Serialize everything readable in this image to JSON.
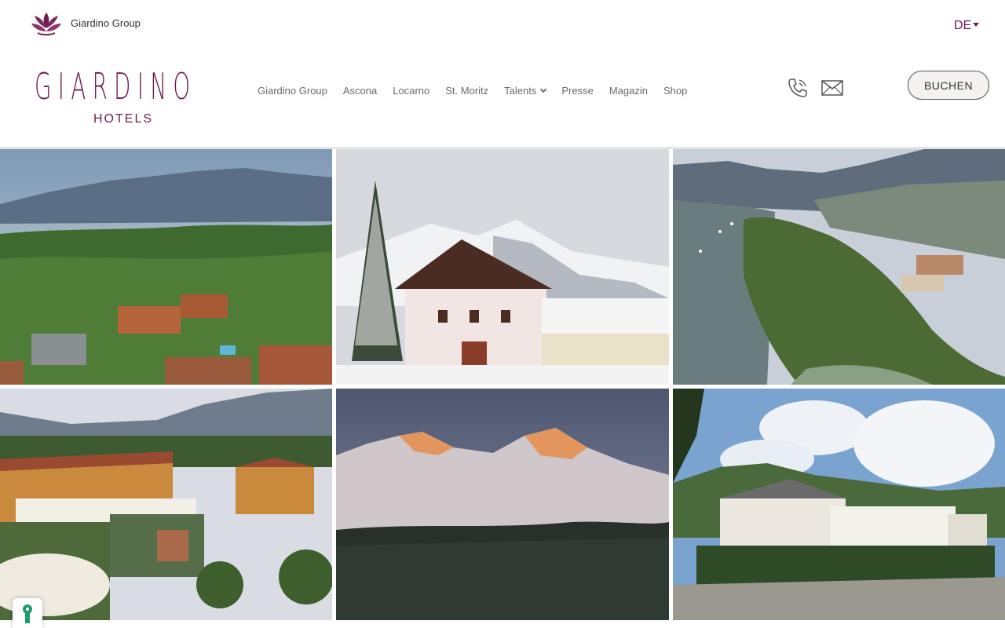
{
  "header": {
    "group_label": "Giardino Group",
    "language": "DE",
    "brand_word": "GIARDINO",
    "brand_sub": "HOTELS",
    "book_label": "BUCHEN",
    "icons": {
      "group_logo": "lotus-icon",
      "phone": "phone-icon",
      "mail": "mail-icon",
      "cookie": "key-icon"
    }
  },
  "nav": {
    "items": [
      "Giardino Group",
      "Ascona",
      "Locarno",
      "St. Moritz",
      "Talents",
      "Presse",
      "Magazin",
      "Shop"
    ]
  },
  "gallery": {
    "tiles": [
      "aerial-ascona-resort",
      "snowy-st-moritz-chalet",
      "lake-maggiore-shore",
      "courtyard-garden-hotel",
      "alpenglow-peaks",
      "villa-locarno"
    ]
  },
  "colors": {
    "brand": "#6e1b4f",
    "nav_text": "#6a6a6a",
    "button_bg": "#f4f2f1",
    "key_green": "#1f9b6e"
  }
}
